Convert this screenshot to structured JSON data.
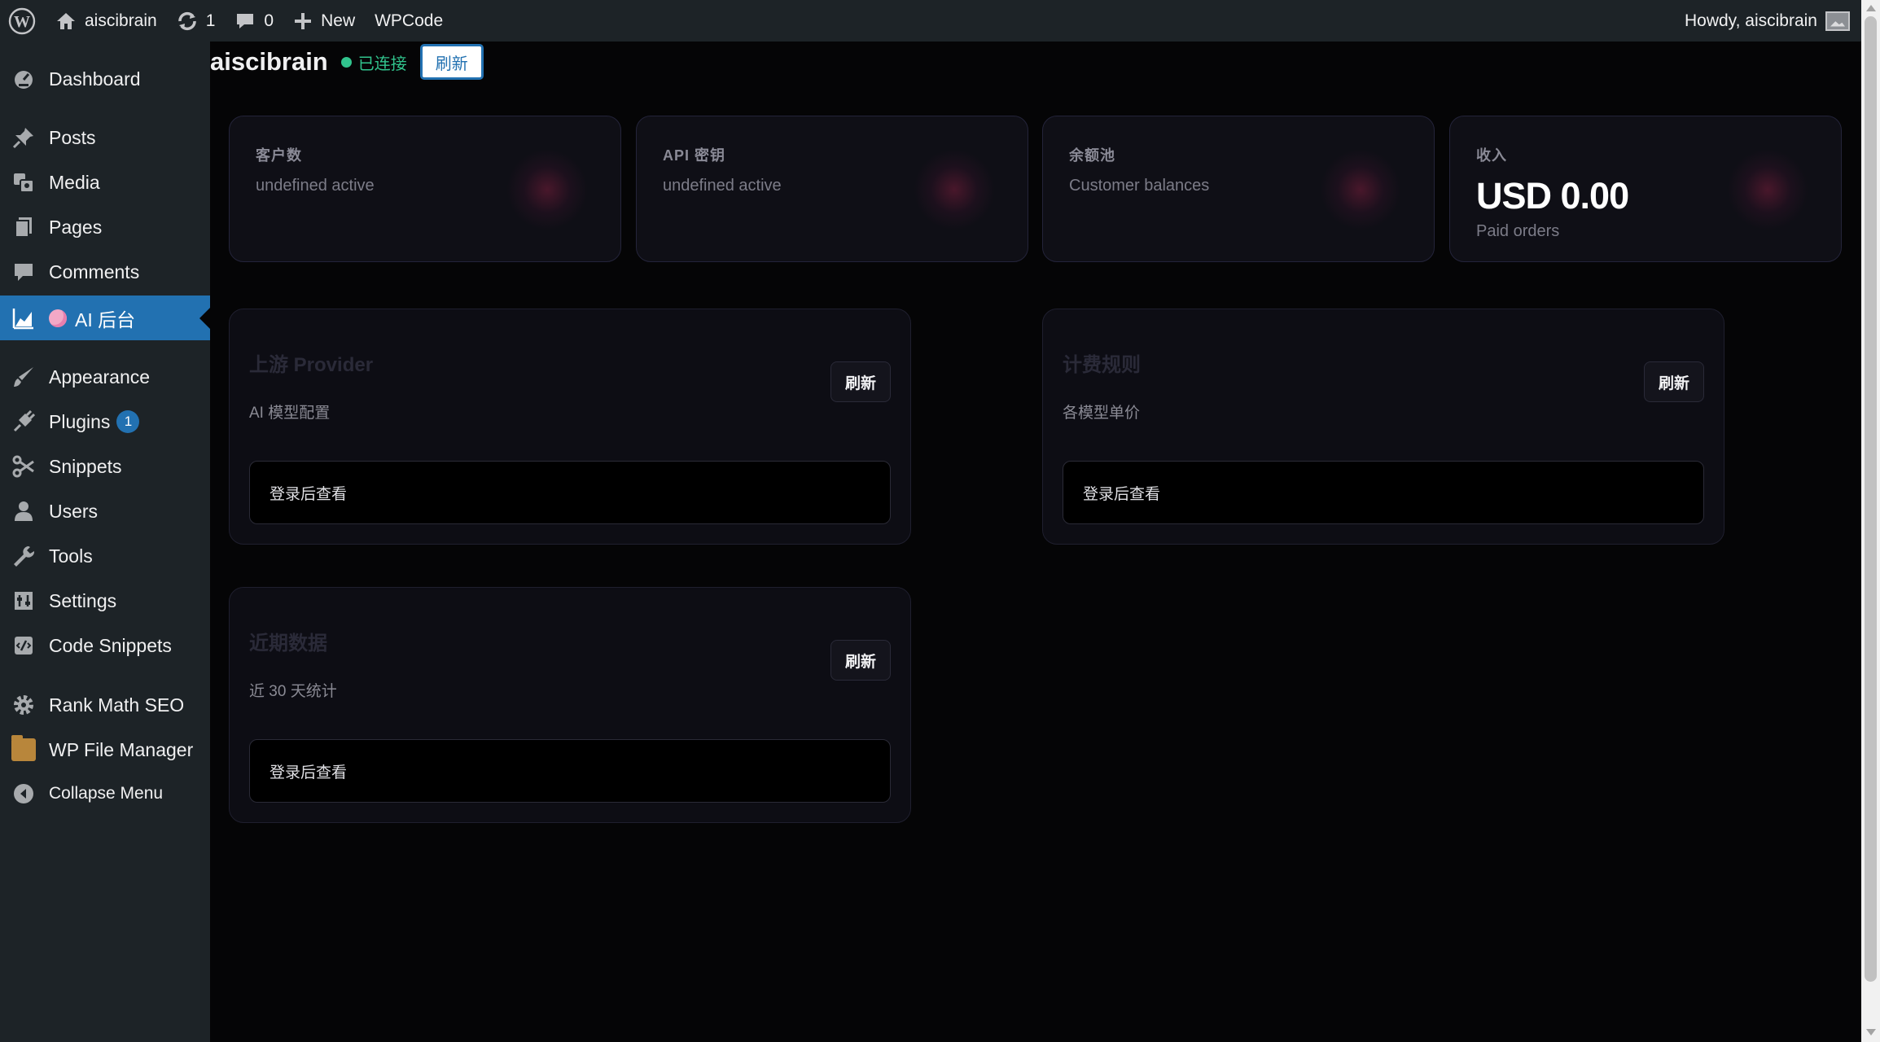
{
  "admin_bar": {
    "site_name": "aiscibrain",
    "updates_count": "1",
    "comments_count": "0",
    "new_label": "New",
    "wpcode_label": "WPCode",
    "greeting": "Howdy, aiscibrain"
  },
  "sidebar": {
    "items": [
      {
        "label": "Dashboard",
        "icon": "dashboard-icon"
      },
      {
        "label": "Posts",
        "icon": "pin-icon"
      },
      {
        "label": "Media",
        "icon": "media-icon"
      },
      {
        "label": "Pages",
        "icon": "pages-icon"
      },
      {
        "label": "Comments",
        "icon": "comment-icon"
      },
      {
        "label": "AI 后台",
        "icon": "chart-icon",
        "active": true
      },
      {
        "label": "Appearance",
        "icon": "brush-icon"
      },
      {
        "label": "Plugins",
        "icon": "plug-icon",
        "badge": "1"
      },
      {
        "label": "Snippets",
        "icon": "scissors-icon"
      },
      {
        "label": "Users",
        "icon": "user-icon"
      },
      {
        "label": "Tools",
        "icon": "wrench-icon"
      },
      {
        "label": "Settings",
        "icon": "settings-icon"
      },
      {
        "label": "Code Snippets",
        "icon": "code-icon"
      },
      {
        "label": "Rank Math SEO",
        "icon": "gear-icon"
      },
      {
        "label": "WP File Manager",
        "icon": "folder-icon"
      },
      {
        "label": "Collapse Menu",
        "icon": "collapse-icon"
      }
    ]
  },
  "header": {
    "title": "aiscibrain",
    "status": "已连接",
    "refresh_label": "刷新"
  },
  "stats": [
    {
      "label": "客户数",
      "value": "",
      "sub": "undefined active"
    },
    {
      "label": "API 密钥",
      "value": "",
      "sub": "undefined active"
    },
    {
      "label": "余额池",
      "value": "",
      "sub": "Customer balances"
    },
    {
      "label": "收入",
      "value": "USD 0.00",
      "sub": "Paid orders"
    }
  ],
  "panels": [
    {
      "title": "上游 Provider",
      "subtitle": "AI 模型配置",
      "refresh_label": "刷新",
      "content": "登录后查看"
    },
    {
      "title": "计费规则",
      "subtitle": "各模型单价",
      "refresh_label": "刷新",
      "content": "登录后查看"
    },
    {
      "title": "近期数据",
      "subtitle": "近 30 天统计",
      "refresh_label": "刷新",
      "content": "登录后查看"
    }
  ],
  "colors": {
    "accent": "#2271b1",
    "connected": "#31c48d",
    "admin_bg": "#1d2327",
    "page_bg": "#050506"
  }
}
